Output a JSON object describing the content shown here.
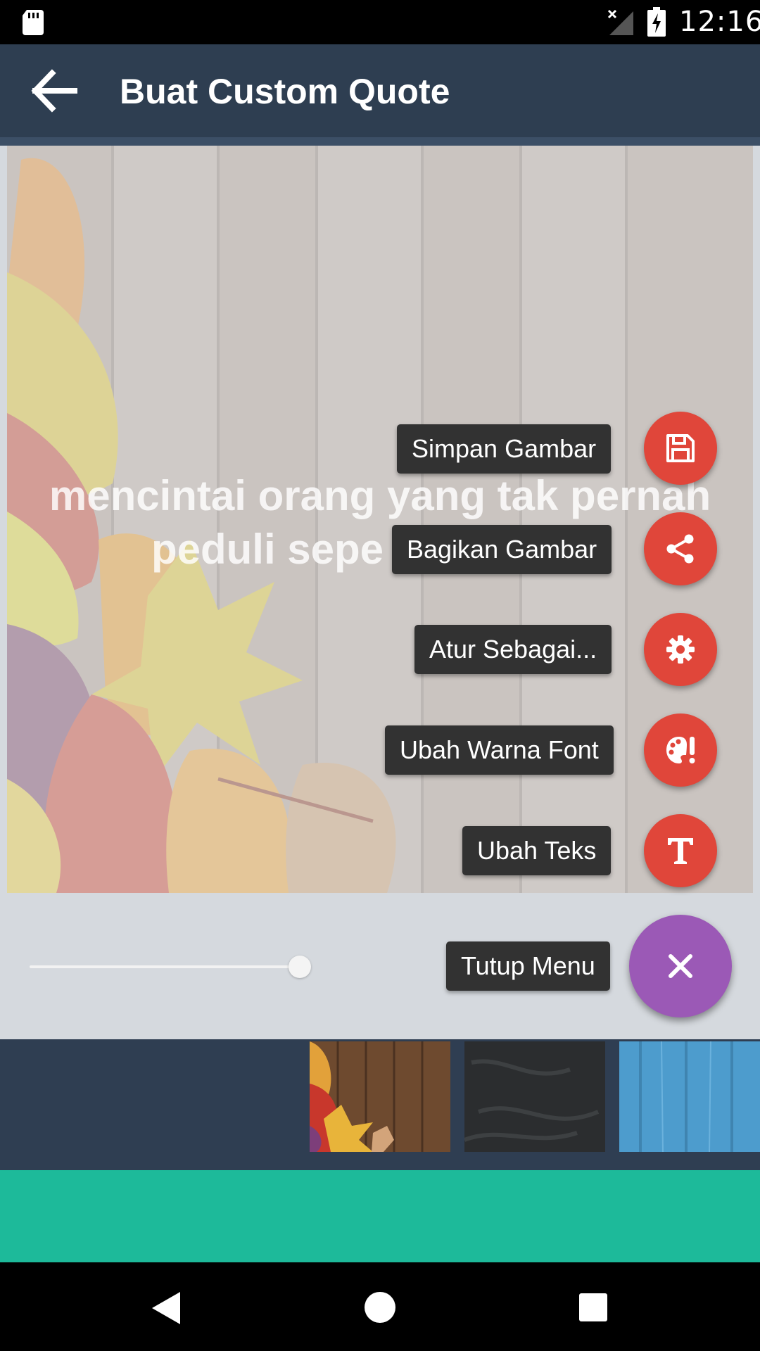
{
  "status_bar": {
    "time": "12:16",
    "icons": [
      "sd-card-icon",
      "signal-off-icon",
      "battery-charging-icon"
    ]
  },
  "app_bar": {
    "title": "Buat Custom Quote",
    "back_icon": "arrow-left-icon"
  },
  "canvas": {
    "quote_line1": "mencintai orang yang tak pernah",
    "quote_line2": "peduli sepe"
  },
  "font_size_slider": {
    "value": 0.73
  },
  "fab_menu": {
    "items": [
      {
        "label": "Simpan Gambar",
        "icon": "floppy-disk-icon"
      },
      {
        "label": "Bagikan Gambar",
        "icon": "share-icon"
      },
      {
        "label": "Atur Sebagai...",
        "icon": "gear-icon"
      },
      {
        "label": "Ubah Warna Font",
        "icon": "palette-icon"
      },
      {
        "label": "Ubah Teks",
        "icon": "text-t-icon"
      }
    ],
    "close_label": "Tutup Menu",
    "close_icon": "close-icon",
    "colors": {
      "action": "#e0463a",
      "main": "#9b59b6"
    }
  },
  "backgrounds": {
    "thumbnails": [
      "autumn-leaves-wood",
      "dark-slate",
      "blue-wood"
    ]
  },
  "colors": {
    "app_bar": "#2e3e51",
    "banner": "#1dba9a"
  }
}
